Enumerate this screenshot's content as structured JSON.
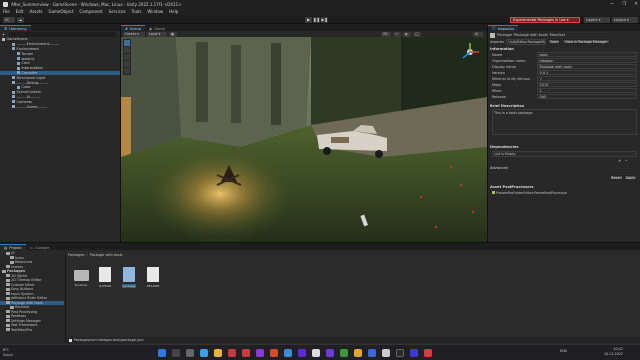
{
  "window": {
    "title": "After_Sommerview - GameScene - Windows, Mac, Linux - Unity 2022.1.17f1 <DX11>",
    "controls": [
      "—",
      "❐",
      "✕"
    ]
  },
  "menu": [
    "File",
    "Edit",
    "Assets",
    "GameObject",
    "Component",
    "Services",
    "Tools",
    "Window",
    "Help"
  ],
  "toolbar": {
    "account": "SC",
    "experimental_label": "Experimental Packages In Use ▾",
    "layers_label": "Layers",
    "layout_label": "Layout"
  },
  "hierarchy": {
    "tab": "Hierarchy",
    "rows": [
      {
        "label": "GameScene",
        "indent": 0,
        "scene": true
      },
      {
        "label": "--------Environment--------",
        "indent": 2
      },
      {
        "label": "Environment",
        "indent": 2
      },
      {
        "label": "Terrain",
        "indent": 3
      },
      {
        "label": "waterly",
        "indent": 3
      },
      {
        "label": "Core",
        "indent": 3
      },
      {
        "label": "Interactable",
        "indent": 3
      },
      {
        "label": "Campfire",
        "indent": 3,
        "selected": true
      },
      {
        "label": "Directional Light",
        "indent": 2
      },
      {
        "label": "--------Debug--------",
        "indent": 2
      },
      {
        "label": "Cube",
        "indent": 3
      },
      {
        "label": "SceneContext",
        "indent": 2
      },
      {
        "label": "--------UI--------",
        "indent": 2
      },
      {
        "label": "Cameras",
        "indent": 2
      },
      {
        "label": "--------Game--------",
        "indent": 2
      }
    ]
  },
  "scene": {
    "tabs": [
      "Scene",
      "Game"
    ],
    "toolbar_left": [
      "Center",
      "Local"
    ],
    "toolbar_right": [
      "2D",
      "☼",
      "◐",
      "◯",
      "⚙"
    ]
  },
  "inspector": {
    "tab": "Inspector",
    "header_title": "Package 'Package with tools' Manifest",
    "importer_label": "Importer",
    "importer_value": "UnityEditor.PackageManagerUI.Pack...",
    "open_btn": "Open",
    "view_pm_btn": "View in Package Manager",
    "info_heading": "Information",
    "fields": [
      {
        "k": "Name",
        "v": "tools"
      },
      {
        "k": "Organization name",
        "v": "ideagon"
      },
      {
        "k": "Display name",
        "v": "Package with tools"
      },
      {
        "k": "Version",
        "v": "0.0.1"
      },
      {
        "k": "Minimal Unity Version",
        "v": "✓"
      },
      {
        "k": "Major",
        "v": "2019"
      },
      {
        "k": "Minor",
        "v": "1"
      },
      {
        "k": "Release",
        "v": "0b5"
      }
    ],
    "brief_heading": "Brief Description",
    "brief_text": "This is a tools package",
    "deps_heading": "Dependencies",
    "deps_empty": "List is Empty",
    "advanced_heading": "Advanced",
    "revert_btn": "Revert",
    "apply_btn": "Apply",
    "postproc_heading": "Asset PostProcessors",
    "postproc_item": "PresetsPerFolderEditor.PresetPostProcessor"
  },
  "project": {
    "tabs": [
      "Project",
      "Console"
    ],
    "breadcrumb": [
      "Packages",
      "Package with tools"
    ],
    "tree": [
      {
        "label": "UI",
        "indent": 1
      },
      {
        "label": "Icons",
        "indent": 2
      },
      {
        "label": "Resources",
        "indent": 2
      },
      {
        "label": "Scenes",
        "indent": 1
      },
      {
        "label": "Packages",
        "indent": 0,
        "bold": true
      },
      {
        "label": "2D Sprite",
        "indent": 1
      },
      {
        "label": "2D Tilemap Editor",
        "indent": 1
      },
      {
        "label": "Custom NUnit",
        "indent": 1
      },
      {
        "label": "Easy Buttons",
        "indent": 1
      },
      {
        "label": "Input System",
        "indent": 1
      },
      {
        "label": "JetBrains Rider Editor",
        "indent": 1
      },
      {
        "label": "Package with tools",
        "indent": 1,
        "selected": true
      },
      {
        "label": "Runtime",
        "indent": 2
      },
      {
        "label": "Post Processing",
        "indent": 1
      },
      {
        "label": "Postfixes",
        "indent": 1
      },
      {
        "label": "Settings Manager",
        "indent": 1
      },
      {
        "label": "Test Framework",
        "indent": 1
      },
      {
        "label": "TextMeshPro",
        "indent": 1
      }
    ],
    "assets": [
      {
        "label": "Runtime",
        "type": "folder"
      },
      {
        "label": "LICENSE",
        "type": "file"
      },
      {
        "label": "package",
        "type": "file",
        "selected": true
      },
      {
        "label": "README",
        "type": "file"
      }
    ],
    "status_path": "Packages/com.ideagon.tools/package.json",
    "count": "16"
  },
  "taskbar": {
    "weather_temp": "8°C",
    "weather_desc": "Sunny",
    "lang": "ENG",
    "time": "10:42",
    "date": "10.11.2022"
  }
}
